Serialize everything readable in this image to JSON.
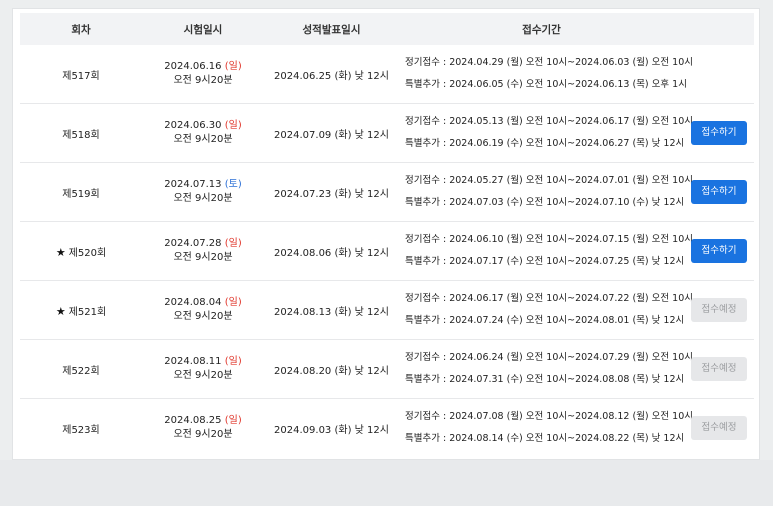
{
  "header": {
    "round": "회차",
    "exam_date": "시험일시",
    "result_date": "성적발표일시",
    "period": "접수기간"
  },
  "rows": [
    {
      "round": "제517회",
      "star": false,
      "date": "2024.06.16",
      "day": "(일)",
      "day_type": "sun",
      "time": "오전 9시20분",
      "result": "2024.06.25 (화) 낮 12시",
      "regular": "정기접수 : 2024.04.29 (월) 오전 10시~2024.06.03 (월) 오전 10시",
      "special": "특별추가 : 2024.06.05 (수) 오전 10시~2024.06.13 (목) 오후 1시",
      "button": ""
    },
    {
      "round": "제518회",
      "star": false,
      "date": "2024.06.30",
      "day": "(일)",
      "day_type": "sun",
      "time": "오전 9시20분",
      "result": "2024.07.09 (화) 낮 12시",
      "regular": "정기접수 : 2024.05.13 (월) 오전 10시~2024.06.17 (월) 오전 10시",
      "special": "특별추가 : 2024.06.19 (수) 오전 10시~2024.06.27 (목) 낮 12시",
      "button": "접수하기",
      "button_type": "apply"
    },
    {
      "round": "제519회",
      "star": false,
      "date": "2024.07.13",
      "day": "(토)",
      "day_type": "sat",
      "time": "오전 9시20분",
      "result": "2024.07.23 (화) 낮 12시",
      "regular": "정기접수 : 2024.05.27 (월) 오전 10시~2024.07.01 (월) 오전 10시",
      "special": "특별추가 : 2024.07.03 (수) 오전 10시~2024.07.10 (수) 낮 12시",
      "button": "접수하기",
      "button_type": "apply"
    },
    {
      "round": "제520회",
      "star": true,
      "date": "2024.07.28",
      "day": "(일)",
      "day_type": "sun",
      "time": "오전 9시20분",
      "result": "2024.08.06 (화) 낮 12시",
      "regular": "정기접수 : 2024.06.10 (월) 오전 10시~2024.07.15 (월) 오전 10시",
      "special": "특별추가 : 2024.07.17 (수) 오전 10시~2024.07.25 (목) 낮 12시",
      "button": "접수하기",
      "button_type": "apply"
    },
    {
      "round": "제521회",
      "star": true,
      "date": "2024.08.04",
      "day": "(일)",
      "day_type": "sun",
      "time": "오전 9시20분",
      "result": "2024.08.13 (화) 낮 12시",
      "regular": "정기접수 : 2024.06.17 (월) 오전 10시~2024.07.22 (월) 오전 10시",
      "special": "특별추가 : 2024.07.24 (수) 오전 10시~2024.08.01 (목) 낮 12시",
      "button": "접수예정",
      "button_type": "soon"
    },
    {
      "round": "제522회",
      "star": false,
      "date": "2024.08.11",
      "day": "(일)",
      "day_type": "sun",
      "time": "오전 9시20분",
      "result": "2024.08.20 (화) 낮 12시",
      "regular": "정기접수 : 2024.06.24 (월) 오전 10시~2024.07.29 (월) 오전 10시",
      "special": "특별추가 : 2024.07.31 (수) 오전 10시~2024.08.08 (목) 낮 12시",
      "button": "접수예정",
      "button_type": "soon"
    },
    {
      "round": "제523회",
      "star": false,
      "date": "2024.08.25",
      "day": "(일)",
      "day_type": "sun",
      "time": "오전 9시20분",
      "result": "2024.09.03 (화) 낮 12시",
      "regular": "정기접수 : 2024.07.08 (월) 오전 10시~2024.08.12 (월) 오전 10시",
      "special": "특별추가 : 2024.08.14 (수) 오전 10시~2024.08.22 (목) 낮 12시",
      "button": "접수예정",
      "button_type": "soon"
    }
  ],
  "star_glyph": "★",
  "colors": {
    "apply": "#1a73e0",
    "sunday": "#e0362b",
    "saturday": "#2b6fd6"
  }
}
